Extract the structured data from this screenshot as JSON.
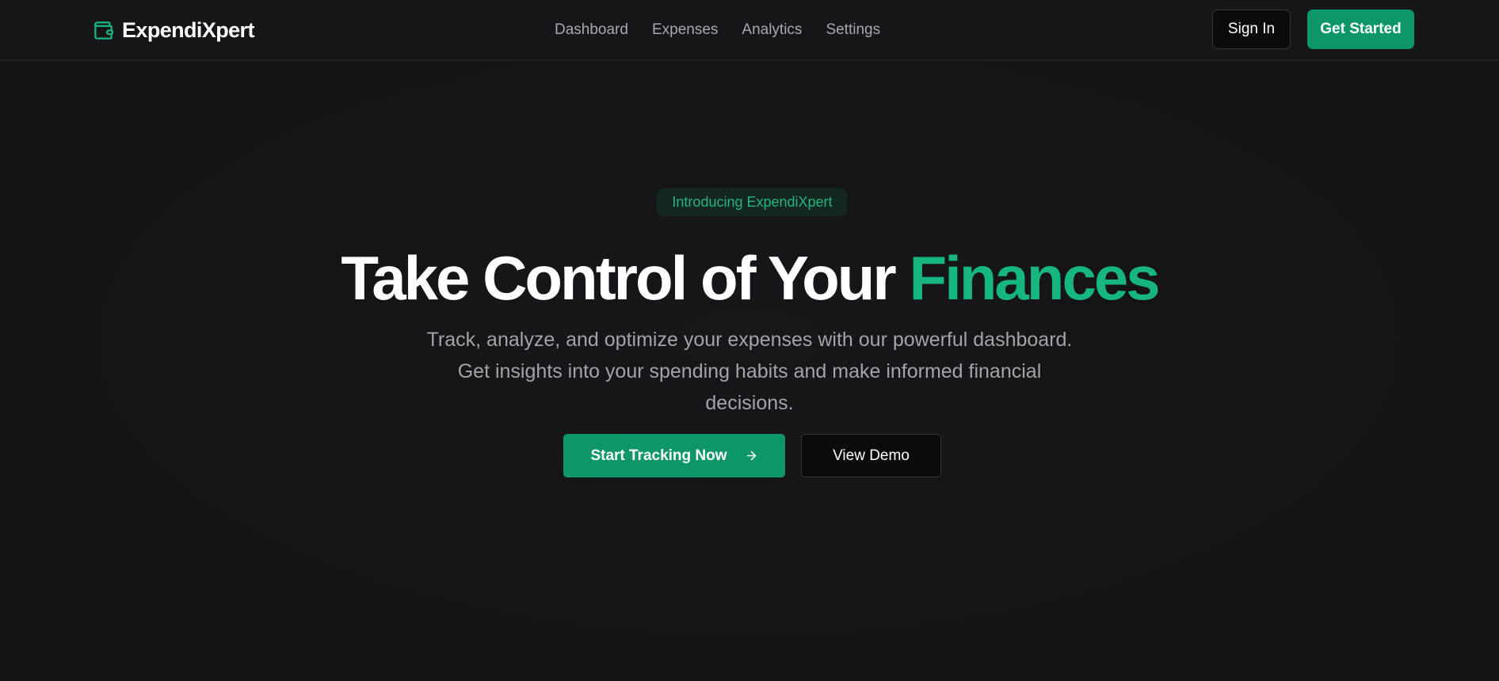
{
  "brand": {
    "name": "ExpendiXpert",
    "icon": "wallet-icon"
  },
  "nav": {
    "items": [
      {
        "label": "Dashboard"
      },
      {
        "label": "Expenses"
      },
      {
        "label": "Analytics"
      },
      {
        "label": "Settings"
      }
    ]
  },
  "header_actions": {
    "sign_in_label": "Sign In",
    "get_started_label": "Get Started"
  },
  "hero": {
    "badge": "Introducing ExpendiXpert",
    "headline_main": "Take Control of Your",
    "headline_accent": "Finances",
    "subtext": "Track, analyze, and optimize your expenses with our powerful dashboard. Get insights into your spending habits and make informed financial decisions.",
    "primary_cta_label": "Start Tracking Now",
    "primary_cta_icon": "arrow-right-icon",
    "secondary_cta_label": "View Demo"
  },
  "colors": {
    "background": "#131316",
    "header_background": "#16161a",
    "accent": "#0d9768",
    "accent_text": "#17b67e",
    "muted_text": "#a3a3aa"
  }
}
